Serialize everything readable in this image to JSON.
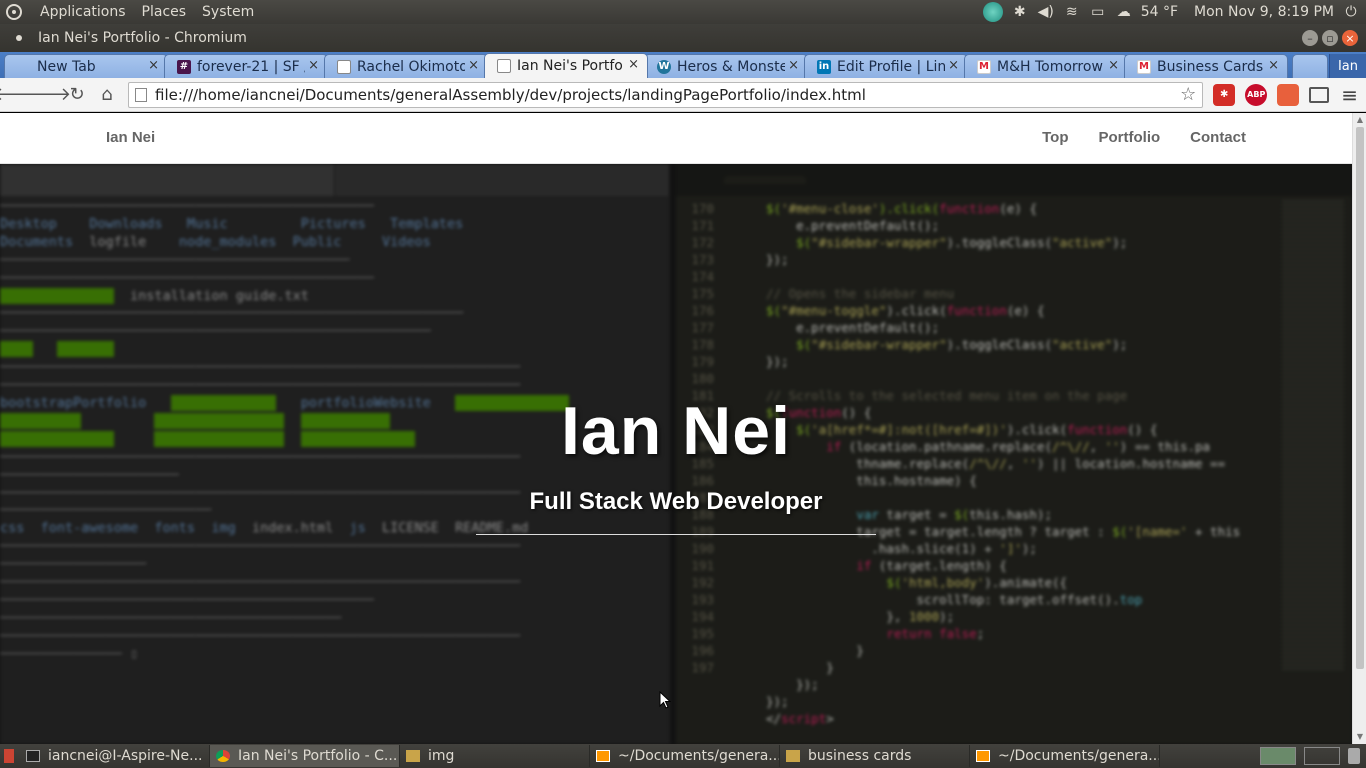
{
  "os_panel": {
    "menus": [
      "Applications",
      "Places",
      "System"
    ],
    "weather": "54 °F",
    "clock": "Mon Nov 9,  8:19 PM"
  },
  "window": {
    "title": "Ian Nei's Portfolio - Chromium"
  },
  "tabs": [
    {
      "label": "New Tab",
      "icon": "blank-page-icon"
    },
    {
      "label": "forever-21 | SF /",
      "icon": "slack-icon"
    },
    {
      "label": "Rachel Okimoto",
      "icon": "document-icon"
    },
    {
      "label": "Ian Nei's Portfo",
      "icon": "document-icon",
      "active": true
    },
    {
      "label": "Heros & Monste",
      "icon": "wordpress-icon"
    },
    {
      "label": "Edit Profile | Lin",
      "icon": "linkedin-icon"
    },
    {
      "label": "M&H Tomorrow",
      "icon": "gmail-icon"
    },
    {
      "label": "Business Cards",
      "icon": "gmail-icon"
    }
  ],
  "profile_label": "Ian",
  "toolbar": {
    "url": "file:///home/iancnei/Documents/generalAssembly/dev/projects/landingPagePortfolio/index.html"
  },
  "site": {
    "brand": "Ian Nei",
    "nav": [
      "Top",
      "Portfolio",
      "Contact"
    ],
    "hero_name": "Ian Nei",
    "hero_role": "Full Stack Web Developer"
  },
  "taskbar": {
    "tasks": [
      {
        "label": "iancnei@I-Aspire-Ne...",
        "icon": "terminal-icon"
      },
      {
        "label": "Ian Nei's Portfolio - C...",
        "icon": "chrome-icon",
        "active": true
      },
      {
        "label": "img",
        "icon": "folder-icon"
      },
      {
        "label": "~/Documents/genera...",
        "icon": "sublime-icon"
      },
      {
        "label": "business cards",
        "icon": "folder-icon"
      },
      {
        "label": "~/Documents/genera...",
        "icon": "sublime-icon"
      }
    ]
  },
  "colors": {
    "tab_strip": "#4c7fc7",
    "panel": "#3c3b37",
    "close_button": "#e9643a"
  }
}
